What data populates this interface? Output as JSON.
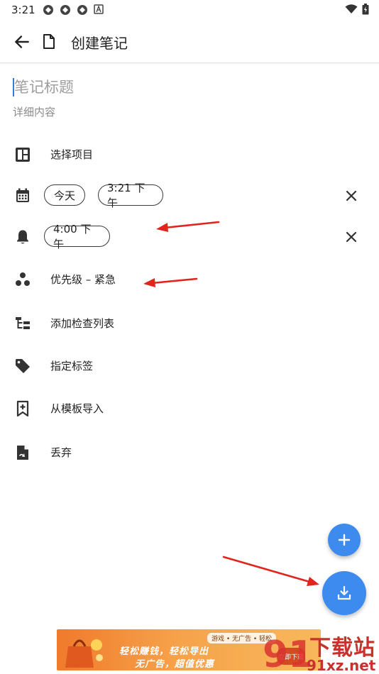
{
  "status_bar": {
    "time": "3:21"
  },
  "header": {
    "title": "创建笔记"
  },
  "note": {
    "title_placeholder": "笔记标题",
    "detail_placeholder": "详细内容"
  },
  "rows": {
    "project": "选择项目",
    "date_chip": "今天",
    "time_chip": "3:21 下午",
    "reminder_chip": "4:00 下午",
    "priority": "优先级 – 紧急",
    "checklist": "添加检查列表",
    "tags": "指定标签",
    "template": "从模板导入",
    "discard": "丢弃"
  },
  "banner": {
    "tabs": "游戏 • 无广告 • 轻松",
    "line1": "轻松赚钱，轻松导出",
    "line2": "无广告，超值优惠",
    "badge": "立即下载"
  },
  "watermark": {
    "cn": "下载站",
    "en": "91xz.net",
    "logo": "91"
  },
  "colors": {
    "accent": "#3d8bef",
    "annotation_arrow": "#e0261c",
    "text": "#222222"
  }
}
